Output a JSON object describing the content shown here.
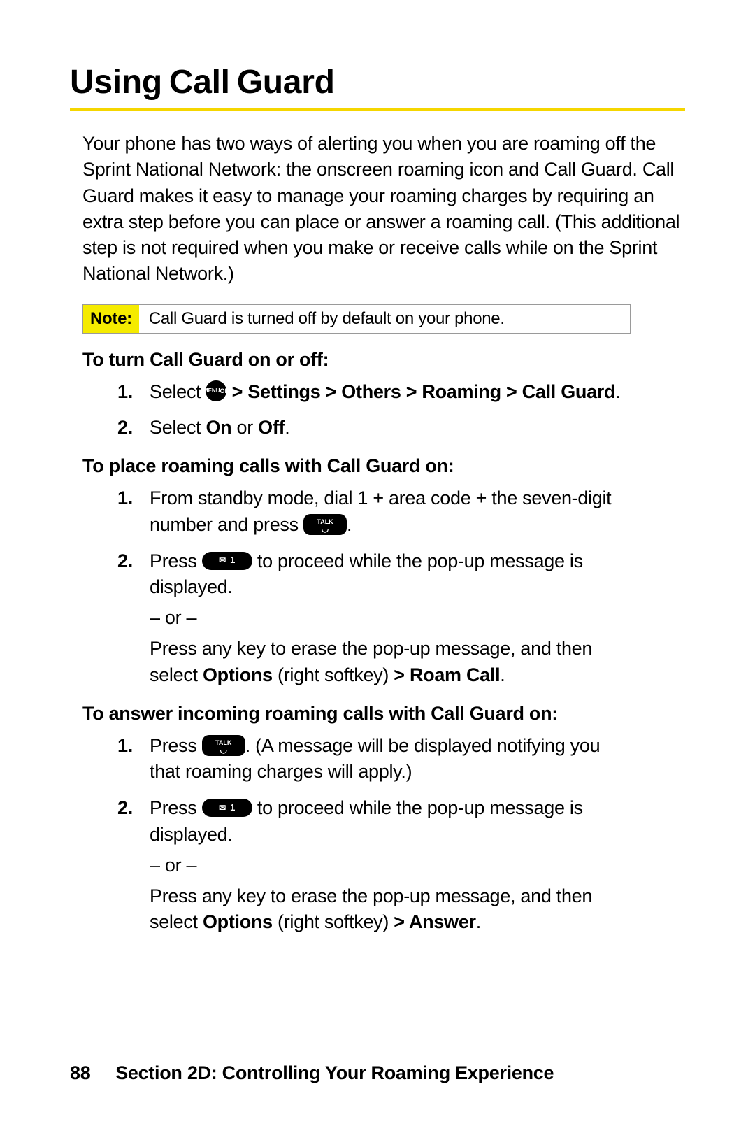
{
  "title": "Using Call Guard",
  "intro": "Your phone has two ways of alerting you when you are roaming off the Sprint National Network: the onscreen roaming icon and Call Guard. Call Guard makes it easy to manage your roaming charges by requiring an extra step before you can place or answer a roaming call. (This additional step is not required when you make or receive calls while on the Sprint National Network.)",
  "note_label": "Note:",
  "note_text": "Call Guard is turned off by default on your phone.",
  "sec1_head": "To turn Call Guard on or off:",
  "sec1_steps": {
    "s1_a": "Select ",
    "s1_b": " > Settings > Others > Roaming > Call Guard",
    "s1_c": ".",
    "s2_a": "Select ",
    "s2_b": "On",
    "s2_c": " or ",
    "s2_d": "Off",
    "s2_e": "."
  },
  "sec2_head": "To place roaming calls with Call Guard on:",
  "sec2_steps": {
    "s1_a": "From standby mode, dial 1 + area code + the seven-digit number and press ",
    "s1_b": ".",
    "s2_a": "Press ",
    "s2_b": " to proceed while the pop-up message is displayed.",
    "s2_or": "– or –",
    "s2_c1": "Press any key to erase the pop-up message, and then select ",
    "s2_c2": "Options",
    "s2_c3": " (right softkey) ",
    "s2_c4": "> Roam Call",
    "s2_c5": "."
  },
  "sec3_head": "To answer incoming roaming calls with Call Guard on:",
  "sec3_steps": {
    "s1_a": "Press ",
    "s1_b": ". (A message will be displayed notifying you that roaming charges will apply.)",
    "s2_a": "Press ",
    "s2_b": " to proceed while the pop-up message is displayed.",
    "s2_or": "– or –",
    "s2_c1": "Press any key to erase the pop-up message, and then select ",
    "s2_c2": "Options",
    "s2_c3": " (right softkey) ",
    "s2_c4": "> Answer",
    "s2_c5": "."
  },
  "icons": {
    "menu_top": "MENU",
    "menu_bottom": "OK",
    "talk": "TALK",
    "one": "1"
  },
  "footer": {
    "page": "88",
    "text": "Section 2D: Controlling Your Roaming Experience"
  }
}
